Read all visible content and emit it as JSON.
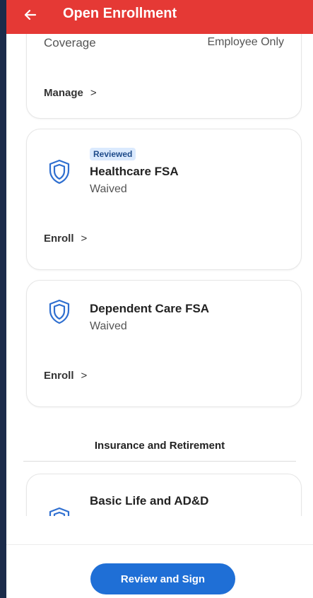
{
  "header": {
    "title": "Open Enrollment",
    "back_icon": "arrow-left-icon",
    "color": "#e53935"
  },
  "coverage_card": {
    "label": "Coverage",
    "value": "Employee Only",
    "action_label": "Manage",
    "chevron": ">"
  },
  "benefits": [
    {
      "icon": "shield-icon",
      "badge": "Reviewed",
      "title": "Healthcare FSA",
      "status": "Waived",
      "action_label": "Enroll",
      "chevron": ">"
    },
    {
      "icon": "shield-icon",
      "title": "Dependent Care FSA",
      "status": "Waived",
      "action_label": "Enroll",
      "chevron": ">"
    }
  ],
  "section": {
    "title": "Insurance and Retirement"
  },
  "insurance_items": [
    {
      "icon": "shield-icon",
      "title": "Basic Life and AD&D"
    }
  ],
  "footer": {
    "primary_button": "Review and Sign",
    "button_color": "#1f6fd6"
  }
}
